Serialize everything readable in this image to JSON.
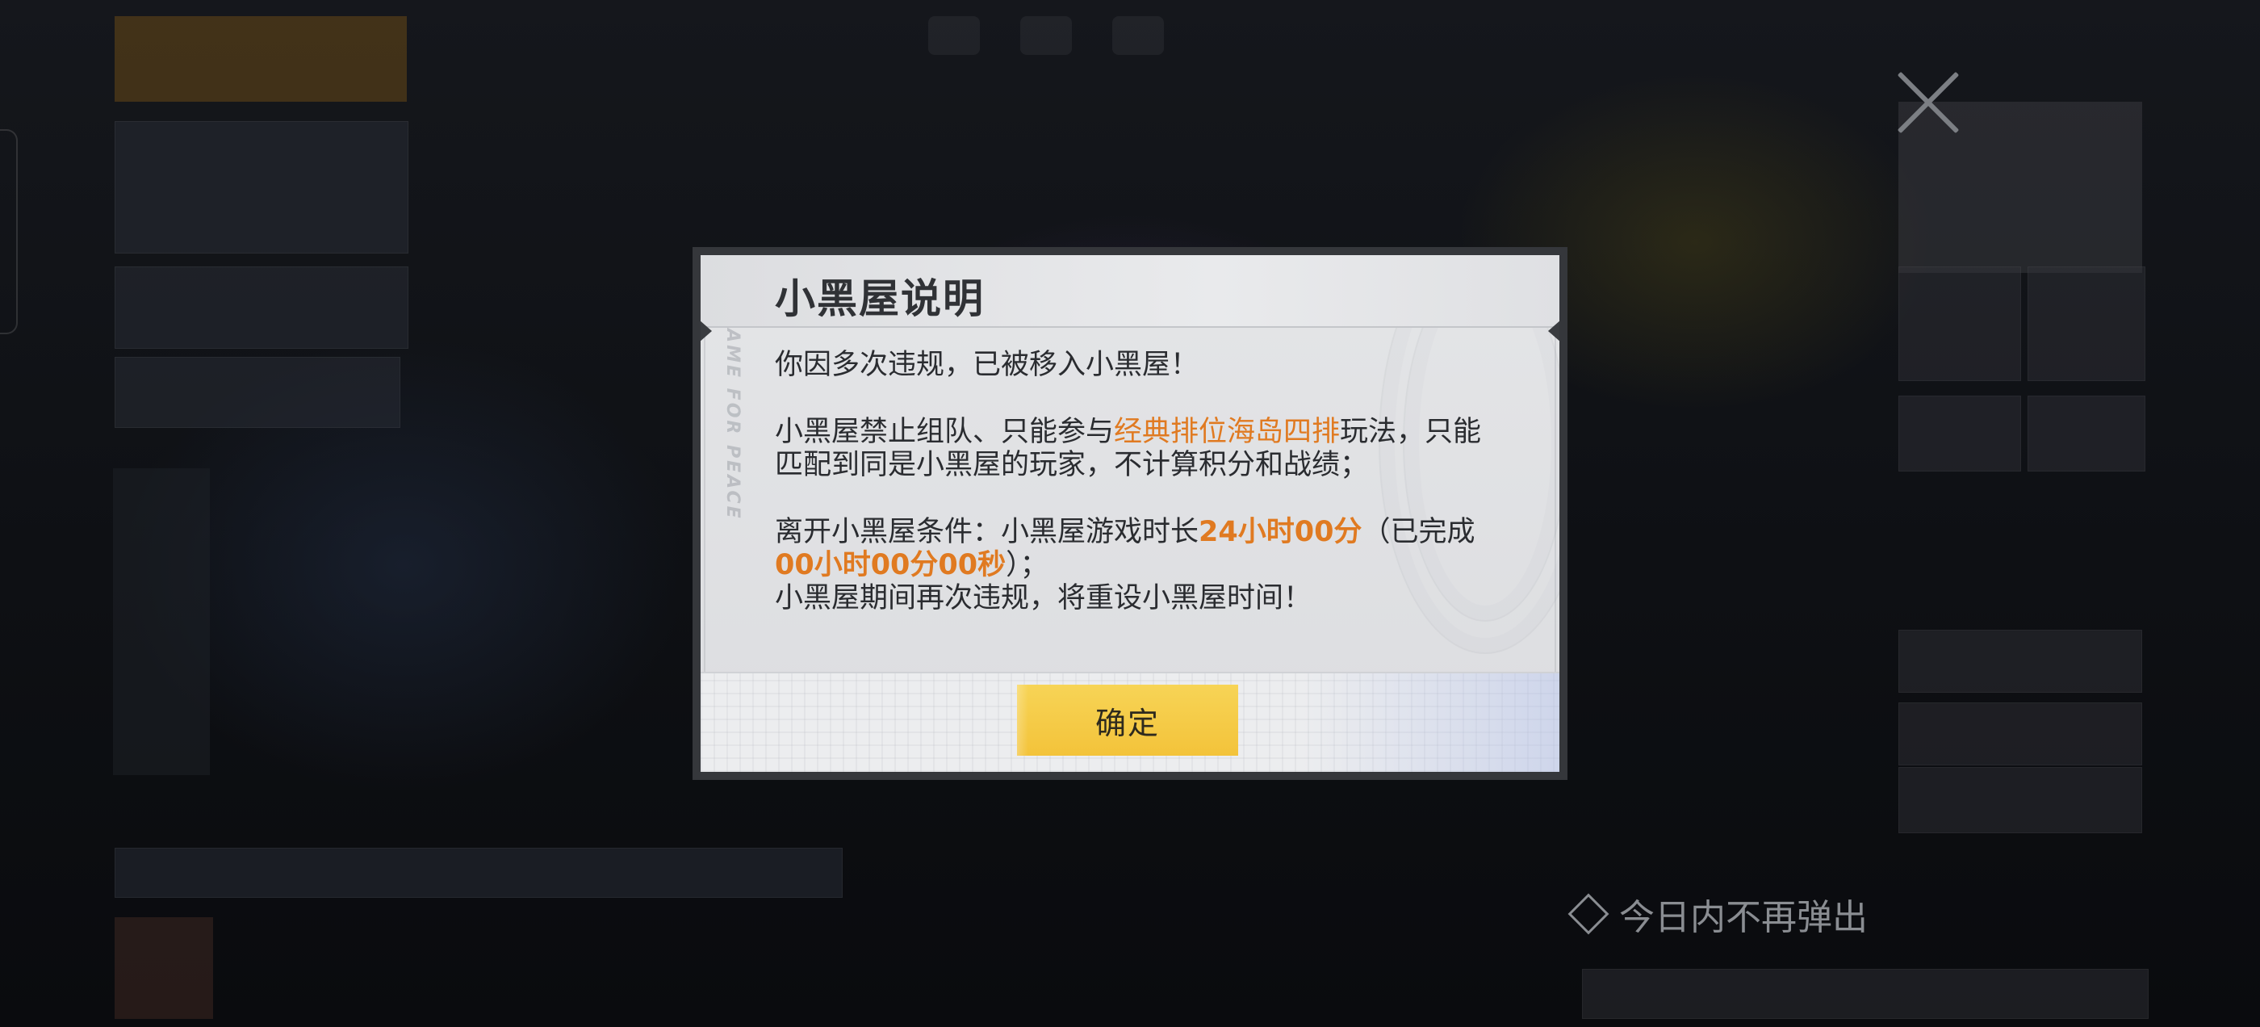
{
  "dialog": {
    "title": "小黑屋说明",
    "para1": "你因多次违规，已被移入小黑屋！",
    "para2_a": "小黑屋禁止组队、只能参与",
    "para2_mode": "经典排位海岛四排",
    "para2_b": "玩法，只能匹配到同是小黑屋的玩家，不计算积分和战绩；",
    "para3_a": "离开小黑屋条件：小黑屋游戏时长",
    "para3_required": "24小时00分",
    "para3_b": "（已完成",
    "para3_done": "00小时00分00秒",
    "para3_c": "）；",
    "para4": "小黑屋期间再次违规，将重设小黑屋时间！",
    "confirm_label": "确定"
  },
  "no_popup_today_label": "今日内不再弹出",
  "colors": {
    "highlight": "#e07a21",
    "confirm_button": "#f5ca45",
    "dialog_frame": "#35373b"
  },
  "icons": {
    "close": "close-icon",
    "checkbox": "diamond-checkbox-icon"
  }
}
